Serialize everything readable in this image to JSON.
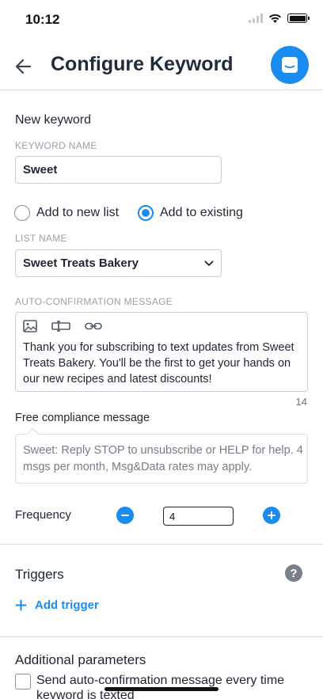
{
  "status_bar": {
    "time": "10:12"
  },
  "header": {
    "title": "Configure Keyword"
  },
  "new_keyword": {
    "heading": "New keyword",
    "keyword_name_label": "KEYWORD NAME",
    "keyword_name_value": "Sweet",
    "radio_new": "Add to new list",
    "radio_existing": "Add to existing",
    "selected_option": "Add to existing",
    "list_name_label": "LIST NAME",
    "list_name_value": "Sweet Treats Bakery",
    "auto_conf_label": "AUTO-CONFIRMATION MESSAGE",
    "auto_conf_message": "Thank you for subscribing to text updates from Sweet Treats Bakery. You'll be the first to get your hands on our new recipes and latest discounts!",
    "char_count": "14"
  },
  "compliance": {
    "heading": "Free compliance message",
    "message": "Sweet: Reply STOP to unsubscribe or HELP for help. 4 msgs per month, Msg&Data rates may apply."
  },
  "frequency": {
    "label": "Frequency",
    "value": "4"
  },
  "triggers": {
    "heading": "Triggers",
    "add_label": "Add trigger"
  },
  "additional": {
    "heading": "Additional parameters",
    "checkbox_label": "Send auto-confirmation message every time keyword is texted"
  },
  "colors": {
    "accent": "#1a8cf0",
    "text": "#1f2633",
    "muted": "#9aa1ab"
  }
}
